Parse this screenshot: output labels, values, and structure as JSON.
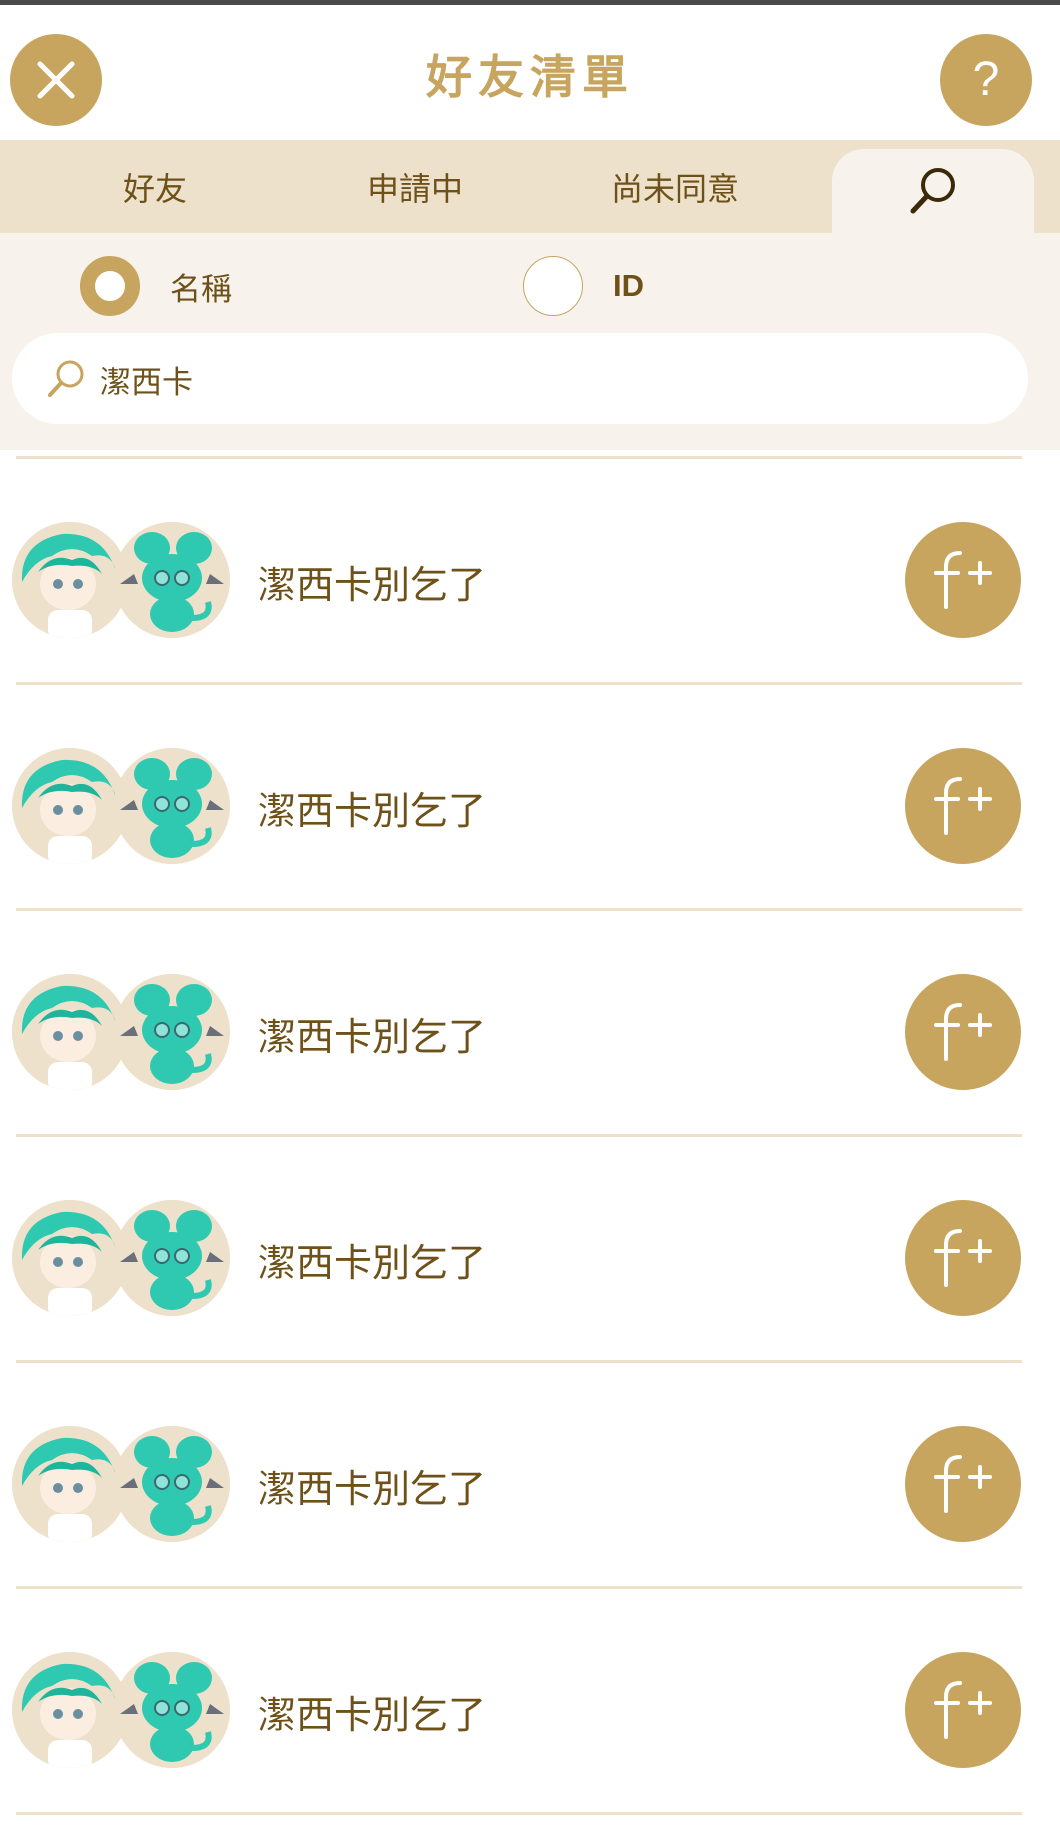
{
  "header": {
    "title": "好友清單",
    "close_icon": "close-icon",
    "help_label": "?"
  },
  "tabs": [
    {
      "label": "好友"
    },
    {
      "label": "申請中"
    },
    {
      "label": "尚未同意"
    },
    {
      "label": "",
      "icon": "search-icon",
      "active": true
    }
  ],
  "search": {
    "options": [
      {
        "label": "名稱",
        "selected": true
      },
      {
        "label": "ID",
        "selected": false
      }
    ],
    "query": "潔西卡"
  },
  "results": [
    {
      "name": "潔西卡別乞了"
    },
    {
      "name": "潔西卡別乞了"
    },
    {
      "name": "潔西卡別乞了"
    },
    {
      "name": "潔西卡別乞了"
    },
    {
      "name": "潔西卡別乞了"
    },
    {
      "name": "潔西卡別乞了"
    }
  ],
  "colors": {
    "accent": "#c8a55e",
    "tab_bar": "#ede1cb",
    "panel": "#f7f3ec",
    "text": "#6e5118",
    "avatar_hair": "#2ec9b0"
  }
}
